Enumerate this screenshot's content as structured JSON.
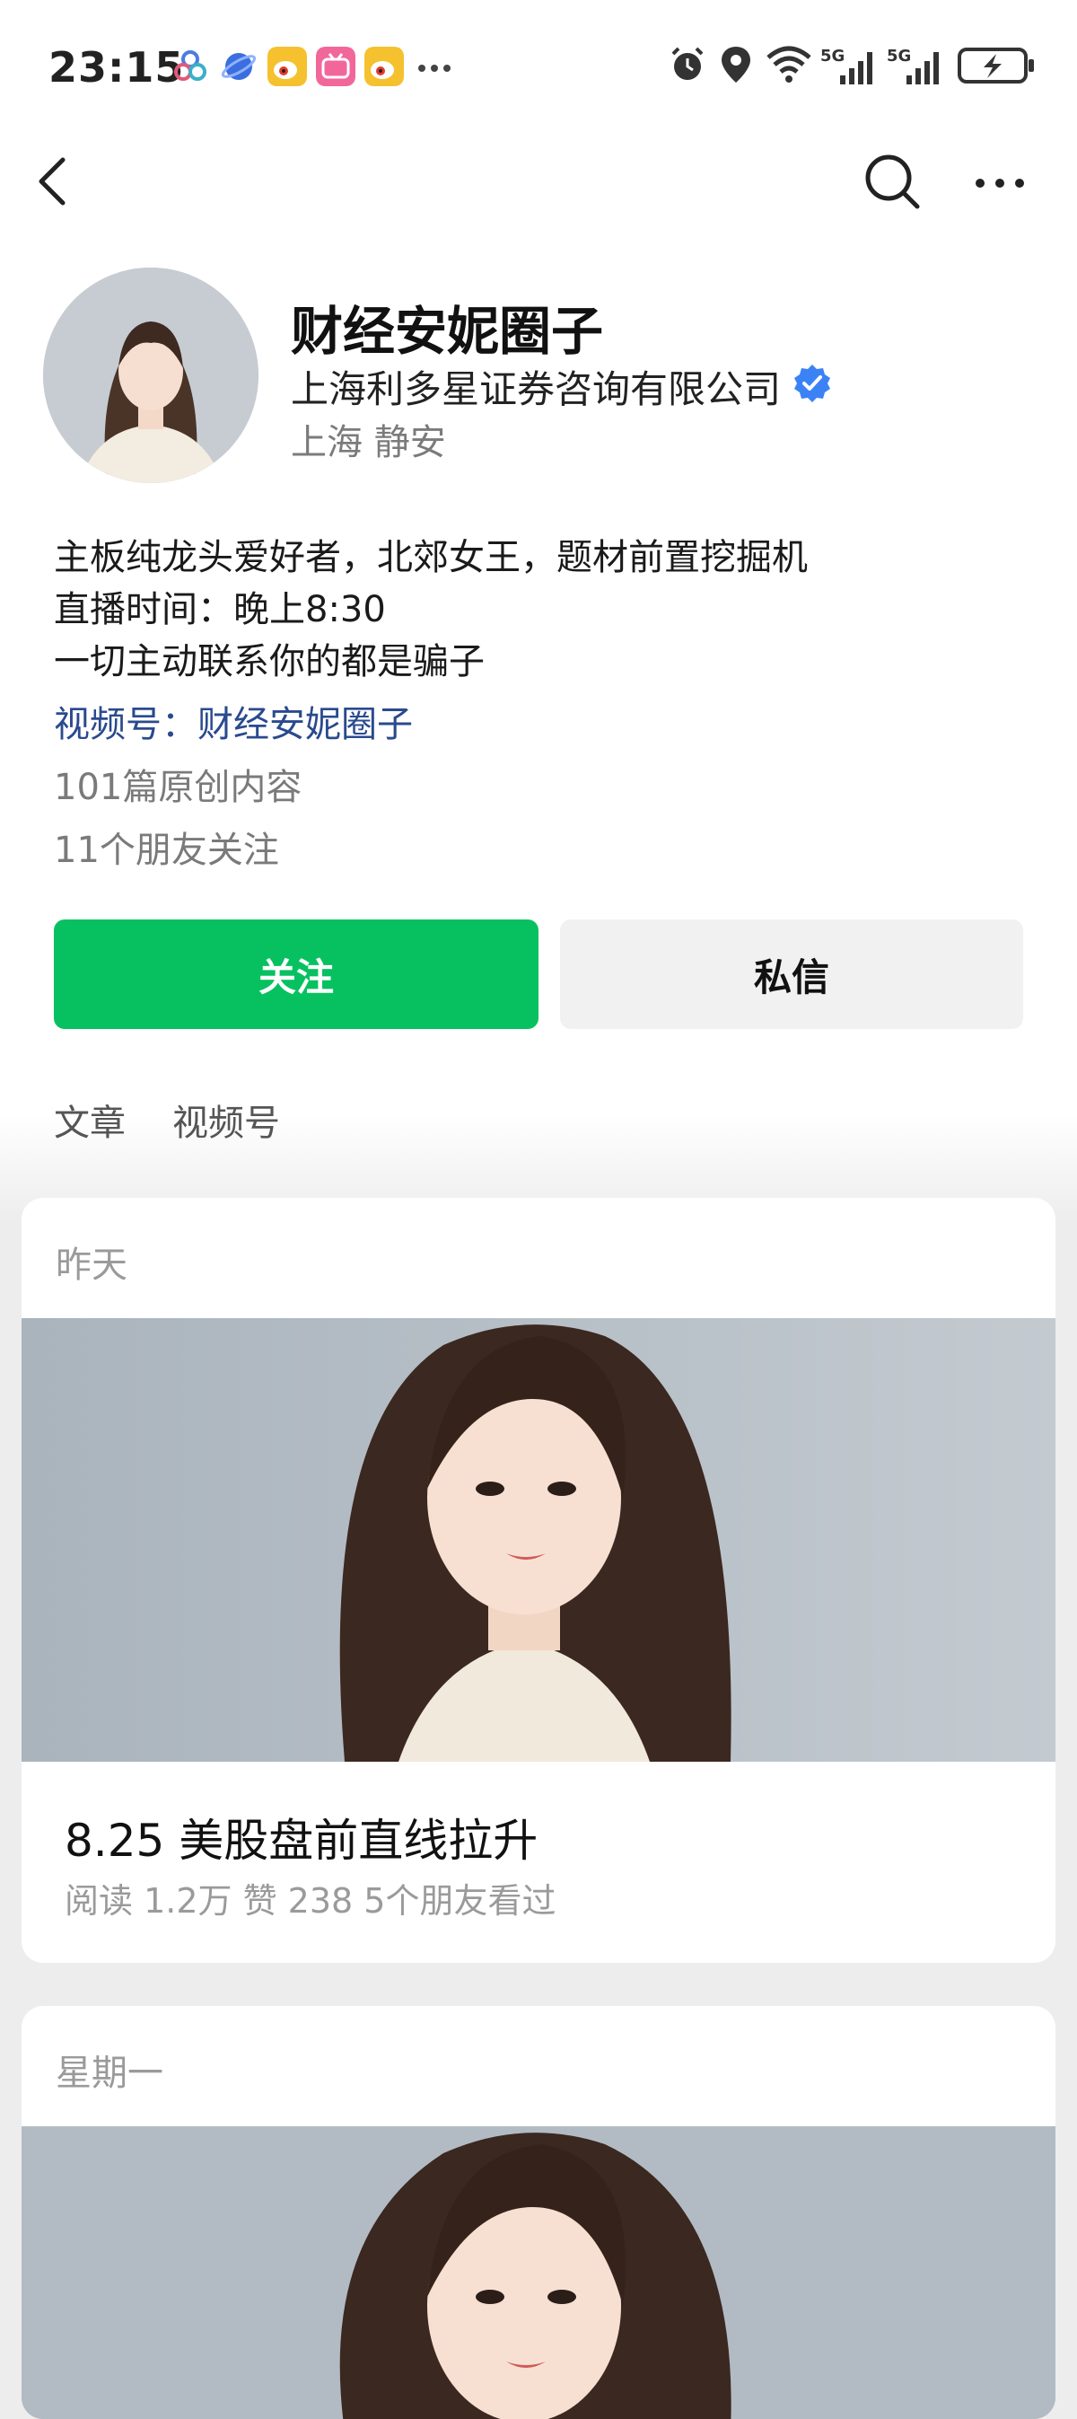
{
  "status_bar": {
    "time": "23:15",
    "notification_icons": [
      "dewflow-icon",
      "planet-icon",
      "weibo-icon",
      "bilibili-icon",
      "weibo-icon",
      "more-dots-icon"
    ],
    "system_icons": [
      "alarm-icon",
      "location-icon",
      "wifi-icon",
      "signal-5g-icon",
      "signal-5g-icon",
      "battery-charging-icon"
    ]
  },
  "nav": {
    "back_icon": "back-chevron-icon",
    "search_icon": "search-icon",
    "more_icon": "more-icon"
  },
  "profile": {
    "name": "财经安妮圈子",
    "company": "上海利多星证券咨询有限公司",
    "location": "上海 静安",
    "bio": [
      "主板纯龙头爱好者，北郊女王，题材前置挖掘机",
      "直播时间：晚上8:30",
      "一切主动联系你的都是骗子"
    ],
    "channel": "视频号：财经安妮圈子",
    "original_count": "101篇原创内容",
    "friends_following": "11个朋友关注"
  },
  "actions": {
    "follow_label": "关注",
    "message_label": "私信"
  },
  "tabs": [
    "文章",
    "视频号"
  ],
  "articles": [
    {
      "date": "昨天",
      "title": "8.25 美股盘前直线拉升",
      "meta": "阅读 1.2万  赞 238  5个朋友看过"
    },
    {
      "date": "星期一"
    }
  ],
  "colors": {
    "accent_green": "#07c160",
    "link_blue": "#2a4a8e",
    "verified_blue": "#3b82f6",
    "page_bg": "#ededed"
  }
}
